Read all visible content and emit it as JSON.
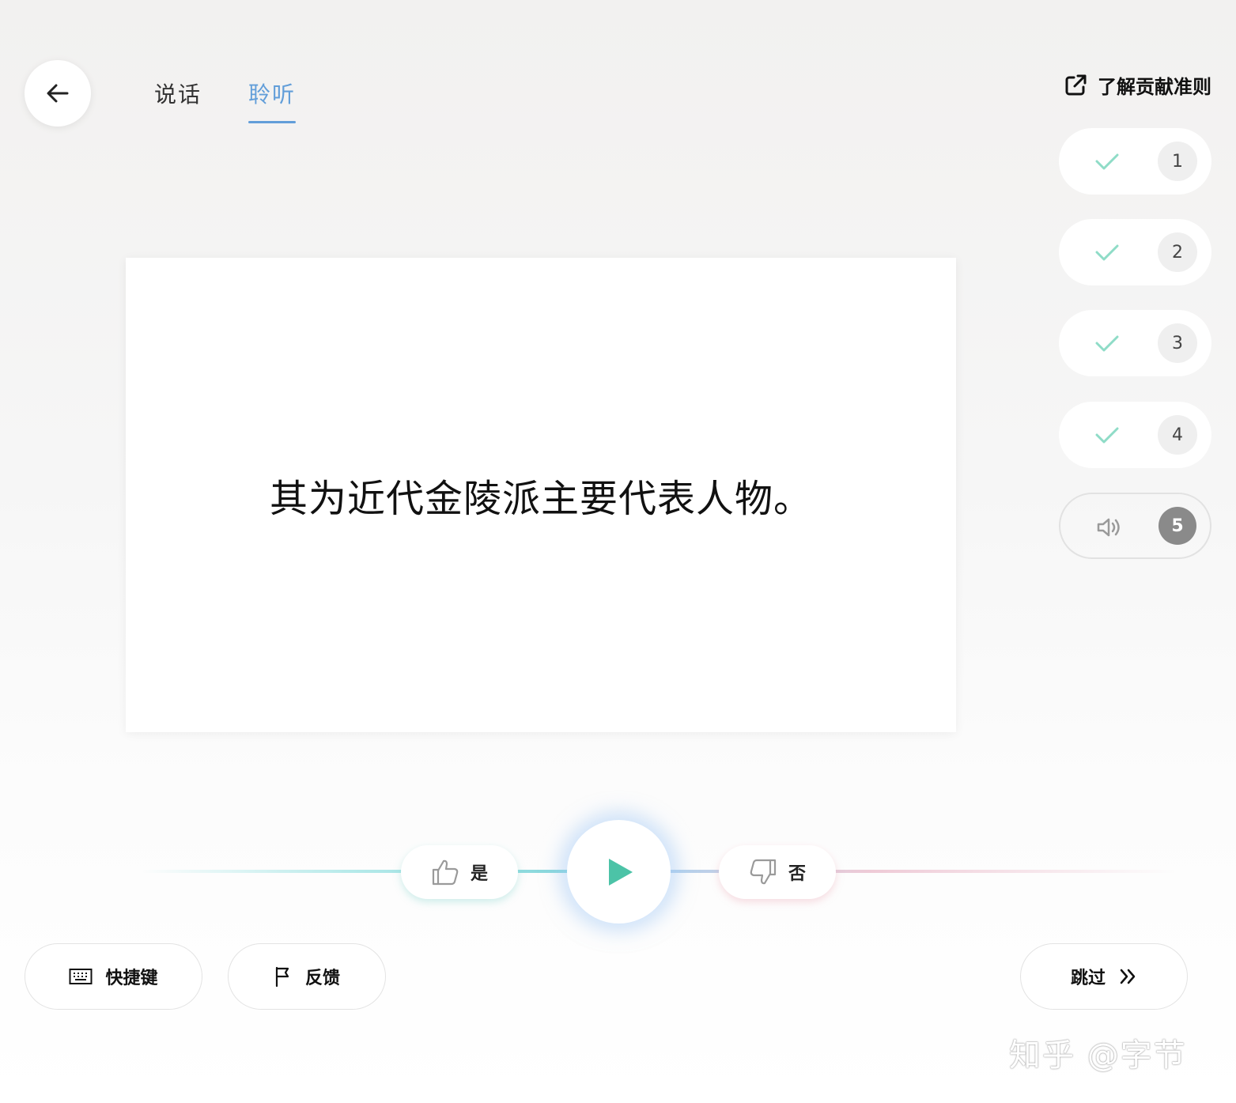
{
  "header": {
    "tabs": [
      {
        "label": "说话",
        "active": false
      },
      {
        "label": "聆听",
        "active": true
      }
    ],
    "guidelines_link": "了解贡献准则",
    "accent_color": "#629ed9"
  },
  "clips": [
    {
      "number": "1",
      "status": "done",
      "icon": "check-icon"
    },
    {
      "number": "2",
      "status": "done",
      "icon": "check-icon"
    },
    {
      "number": "3",
      "status": "done",
      "icon": "check-icon"
    },
    {
      "number": "4",
      "status": "done",
      "icon": "check-icon"
    },
    {
      "number": "5",
      "status": "current",
      "icon": "speaker-icon"
    }
  ],
  "card": {
    "sentence": "其为近代金陵派主要代表人物。"
  },
  "controls": {
    "yes_label": "是",
    "no_label": "否",
    "play_color": "#4cc3a7"
  },
  "bottom": {
    "shortcuts_label": "快捷键",
    "feedback_label": "反馈",
    "skip_label": "跳过"
  },
  "watermark": "知乎 @字节"
}
